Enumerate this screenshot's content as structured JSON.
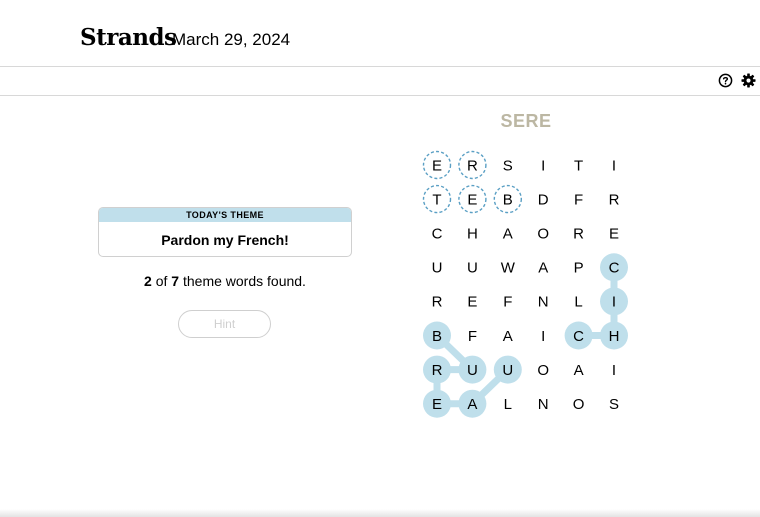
{
  "header": {
    "logo": "Strands",
    "date": "March 29, 2024"
  },
  "toolbar": {
    "icons": [
      "help-icon",
      "gear-icon"
    ]
  },
  "theme": {
    "label": "TODAY'S THEME",
    "title": "Pardon my French!"
  },
  "progress": {
    "found": "2",
    "of": "of",
    "total": "7",
    "suffix": "theme words found."
  },
  "hint": {
    "label": "Hint"
  },
  "current_word": "SERE",
  "grid": [
    [
      "E",
      "R",
      "S",
      "I",
      "T",
      "I"
    ],
    [
      "T",
      "E",
      "B",
      "D",
      "F",
      "R"
    ],
    [
      "C",
      "H",
      "A",
      "O",
      "R",
      "E"
    ],
    [
      "U",
      "U",
      "W",
      "A",
      "P",
      "C"
    ],
    [
      "R",
      "E",
      "F",
      "N",
      "L",
      "I"
    ],
    [
      "B",
      "F",
      "A",
      "I",
      "C",
      "H"
    ],
    [
      "R",
      "U",
      "U",
      "O",
      "A",
      "I"
    ],
    [
      "E",
      "A",
      "L",
      "N",
      "O",
      "S"
    ]
  ],
  "selected_cells": [
    [
      0,
      0
    ],
    [
      0,
      1
    ],
    [
      1,
      0
    ],
    [
      1,
      1
    ],
    [
      1,
      2
    ]
  ],
  "found_words": [
    {
      "path": [
        [
          3,
          5
        ],
        [
          4,
          5
        ],
        [
          5,
          5
        ],
        [
          5,
          4
        ]
      ]
    },
    {
      "path": [
        [
          5,
          0
        ],
        [
          6,
          1
        ],
        [
          6,
          0
        ],
        [
          7,
          0
        ],
        [
          7,
          1
        ],
        [
          6,
          2
        ]
      ]
    }
  ],
  "colors": {
    "found": "#bfdfeb",
    "selected_ring": "#5a9fc4",
    "current_word": "#bcb7a3"
  }
}
